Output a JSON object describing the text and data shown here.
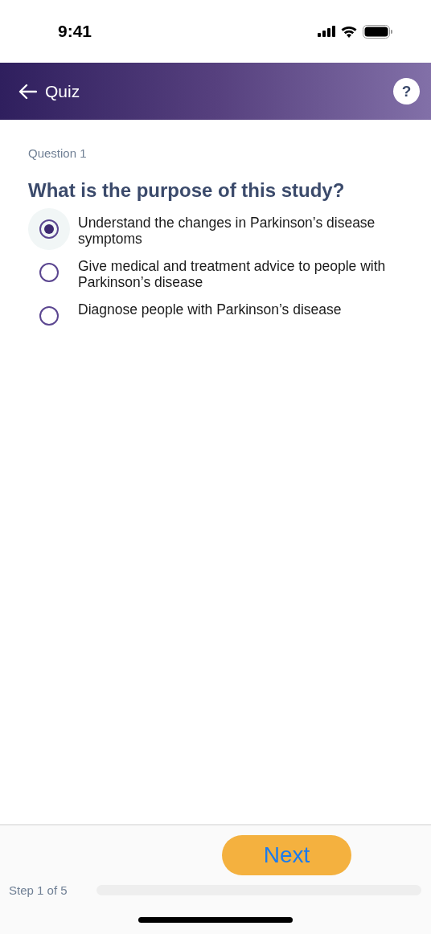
{
  "status_bar": {
    "time": "9:41"
  },
  "header": {
    "title": "Quiz",
    "help": "?"
  },
  "question": {
    "number": "Question 1",
    "text": "What is the purpose of this study?"
  },
  "options": [
    {
      "label": "Understand the changes in Parkinson’s disease symptoms",
      "selected": true
    },
    {
      "label": "Give medical and treatment advice to people with Parkinson’s disease",
      "selected": false
    },
    {
      "label": "Diagnose people with Parkinson’s disease",
      "selected": false
    }
  ],
  "footer": {
    "button": "Next",
    "step": "Step 1 of 5",
    "progress": {
      "level": 0
    }
  }
}
